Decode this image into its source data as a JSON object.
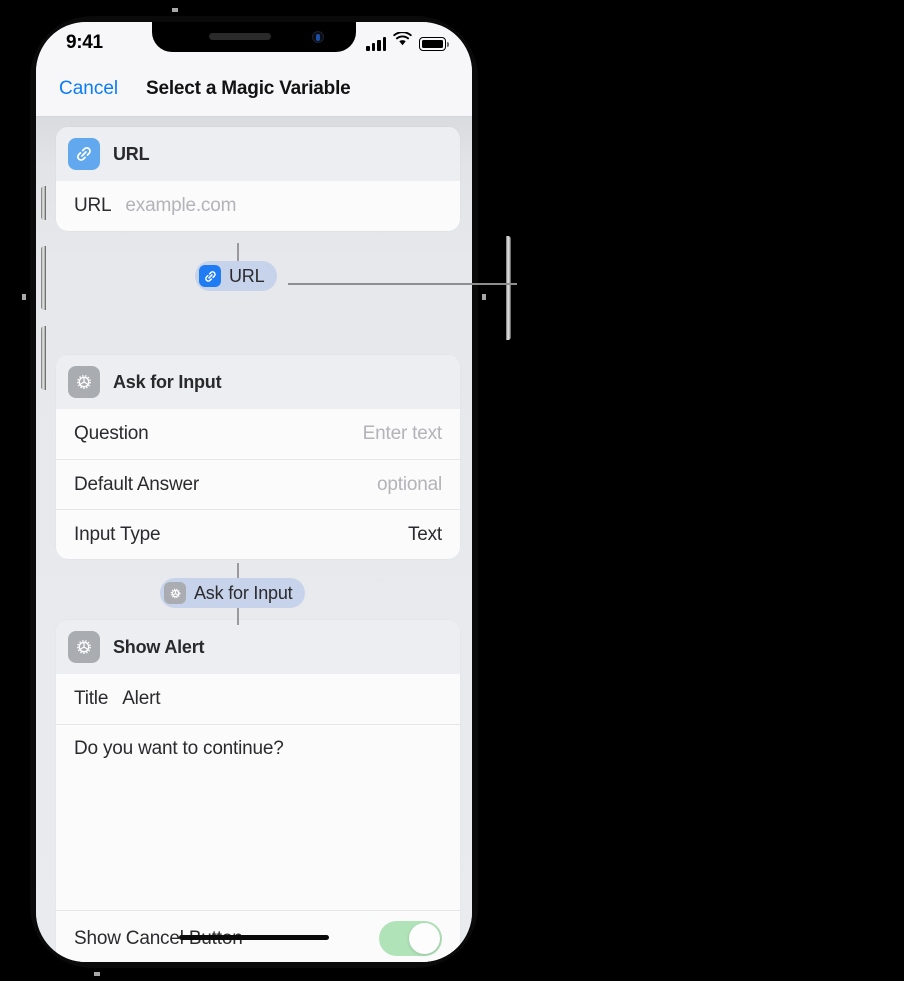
{
  "status_bar": {
    "time": "9:41",
    "icons": [
      "cellular-signal-icon",
      "wifi-icon",
      "battery-icon"
    ]
  },
  "nav_bar": {
    "cancel_label": "Cancel",
    "title": "Select a Magic Variable"
  },
  "colors": {
    "accent_blue": "#0b7cf8",
    "link_icon_blue": "#61a8ee",
    "pill_icon_blue": "#1f7cf2",
    "pill_background": "#c7d3ea",
    "gear_icon_gray": "#a9adb2",
    "toggle_on_green": "#b1e3b9",
    "screen_background": "#e6e8ec"
  },
  "cards": [
    {
      "id": "url-card",
      "icon": "link-icon",
      "title": "URL",
      "rows": [
        {
          "label": "URL",
          "value": "example.com",
          "value_style": "placeholder"
        }
      ]
    },
    {
      "id": "ask-for-input-card",
      "icon": "gear-icon",
      "title": "Ask for Input",
      "rows": [
        {
          "label": "Question",
          "value": "Enter text",
          "value_style": "placeholder"
        },
        {
          "label": "Default Answer",
          "value": "optional",
          "value_style": "placeholder"
        },
        {
          "label": "Input Type",
          "value": "Text",
          "value_style": "normal"
        }
      ]
    },
    {
      "id": "show-alert-card",
      "icon": "gear-icon",
      "title": "Show Alert",
      "rows": [
        {
          "label": "Title",
          "value": "Alert",
          "value_style": "inline"
        },
        {
          "label": "Do you want to continue?",
          "value": "",
          "value_style": "textarea"
        },
        {
          "label": "Show Cancel Button",
          "value": "on",
          "value_style": "toggle"
        }
      ]
    }
  ],
  "magic_variables": [
    {
      "id": "url-magic-variable",
      "icon": "link-icon",
      "label": "URL",
      "selected": true
    },
    {
      "id": "ask-for-input-magic-variable",
      "icon": "gear-icon",
      "label": "Ask for Input",
      "selected": false
    }
  ],
  "callout": {
    "target": "url-magic-variable",
    "description": "leader line pointing to the URL magic variable"
  }
}
